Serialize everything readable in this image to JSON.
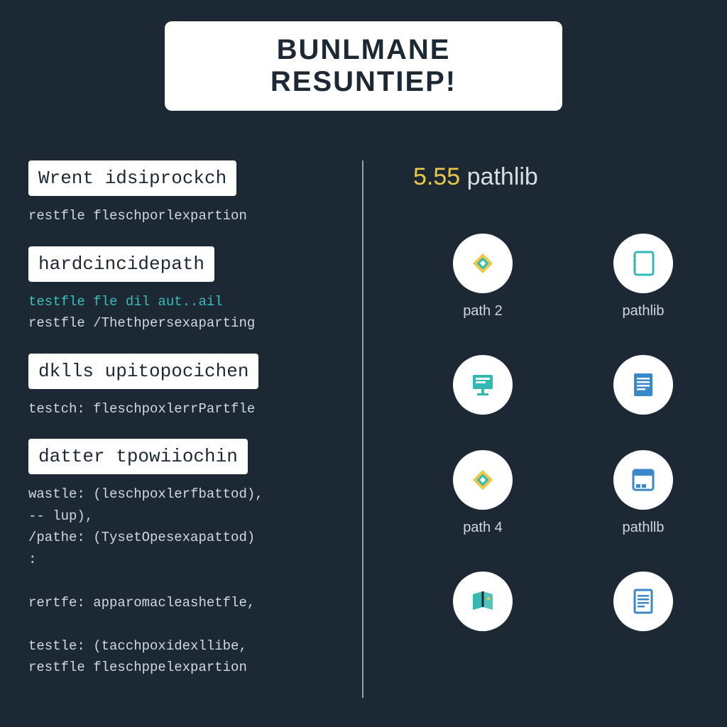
{
  "title": "BUNLMANE RESUNTIEP!",
  "left": {
    "blocks": [
      {
        "label": "Wrent idsiprockch",
        "lines": [
          {
            "text": "restfle fleschporlexpartion",
            "class": ""
          }
        ]
      },
      {
        "label": "hardcincidepath",
        "lines": [
          {
            "text": "testfle fle dil aut..ail",
            "class": "teal"
          },
          {
            "text": "restfle /Thethpersexaparting",
            "class": ""
          }
        ]
      },
      {
        "label": "dklls upitopocichen",
        "lines": [
          {
            "text": "testch: fleschpoxlerrPartfle",
            "class": ""
          }
        ]
      },
      {
        "label": "datter tpowiiochin",
        "lines": [
          {
            "text": "wastle: (leschpoxlerfbattod),",
            "class": ""
          },
          {
            "text": "-- lup),",
            "class": ""
          },
          {
            "text": "/pathe: (TysetOpesexapattod)",
            "class": ""
          },
          {
            "text": ":",
            "class": ""
          },
          {
            "text": " ",
            "class": ""
          },
          {
            "text": "rertfe: apparomacleashetfle,",
            "class": ""
          },
          {
            "text": " ",
            "class": ""
          },
          {
            "text": "testle: (tacchpoxidexllibe,",
            "class": ""
          },
          {
            "text": "restfle fleschppelexpartion",
            "class": ""
          }
        ]
      }
    ]
  },
  "right": {
    "headerNumber": "5.55",
    "headerText": "pathlib",
    "icons": [
      {
        "type": "diamond",
        "label": "path 2"
      },
      {
        "type": "notebook",
        "label": "pathlib"
      },
      {
        "type": "monitor",
        "label": ""
      },
      {
        "type": "sheet",
        "label": ""
      },
      {
        "type": "diamond",
        "label": "path 4"
      },
      {
        "type": "window",
        "label": "pathllb"
      },
      {
        "type": "book",
        "label": ""
      },
      {
        "type": "doc",
        "label": ""
      }
    ]
  },
  "colors": {
    "teal": "#34b8b2",
    "yellow": "#e9c84a",
    "blue": "#3a87c9",
    "bg": "#1d2835"
  }
}
